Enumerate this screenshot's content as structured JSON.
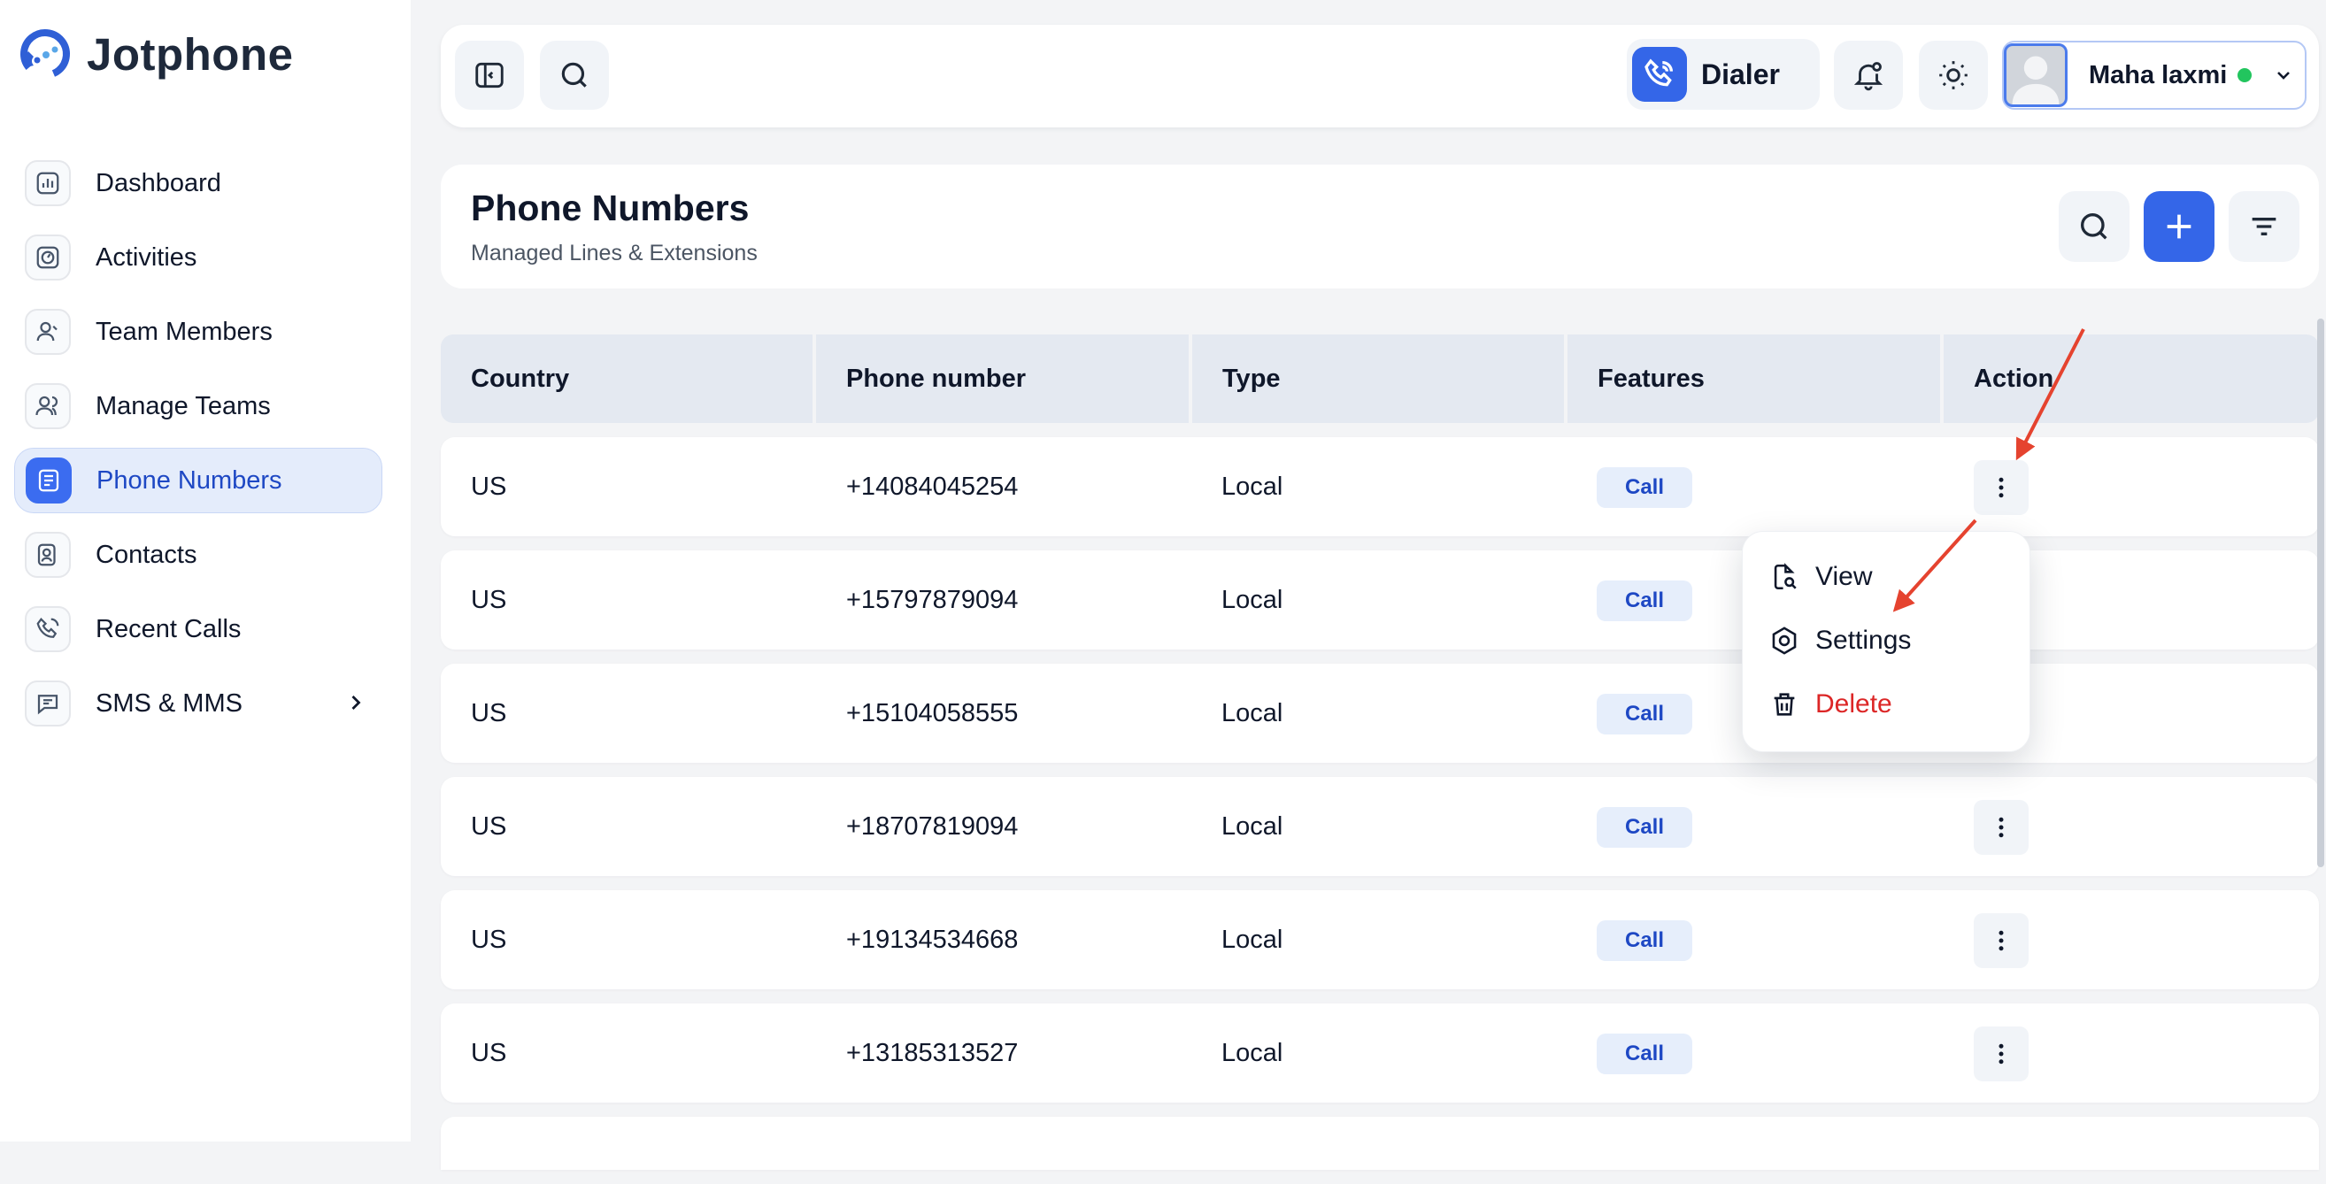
{
  "app": {
    "name": "Jotphone"
  },
  "sidebar": {
    "items": [
      {
        "label": "Dashboard",
        "icon": "chart-icon",
        "active": false
      },
      {
        "label": "Activities",
        "icon": "activity-icon",
        "active": false
      },
      {
        "label": "Team Members",
        "icon": "team-members-icon",
        "active": false
      },
      {
        "label": "Manage Teams",
        "icon": "manage-teams-icon",
        "active": false
      },
      {
        "label": "Phone Numbers",
        "icon": "phone-book-icon",
        "active": true
      },
      {
        "label": "Contacts",
        "icon": "contacts-icon",
        "active": false
      },
      {
        "label": "Recent Calls",
        "icon": "recent-calls-icon",
        "active": false
      },
      {
        "label": "SMS & MMS",
        "icon": "message-icon",
        "active": false,
        "has_submenu": true
      }
    ]
  },
  "topbar": {
    "dialer_label": "Dialer",
    "user_name": "Maha laxmi",
    "user_status_color": "#22c55e"
  },
  "page": {
    "title": "Phone Numbers",
    "subtitle": "Managed Lines & Extensions"
  },
  "table": {
    "columns": [
      "Country",
      "Phone number",
      "Type",
      "Features",
      "Action"
    ],
    "rows": [
      {
        "country": "US",
        "phone": "+14084045254",
        "type": "Local",
        "feature": "Call"
      },
      {
        "country": "US",
        "phone": "+15797879094",
        "type": "Local",
        "feature": "Call"
      },
      {
        "country": "US",
        "phone": "+15104058555",
        "type": "Local",
        "feature": "Call"
      },
      {
        "country": "US",
        "phone": "+18707819094",
        "type": "Local",
        "feature": "Call"
      },
      {
        "country": "US",
        "phone": "+19134534668",
        "type": "Local",
        "feature": "Call"
      },
      {
        "country": "US",
        "phone": "+13185313527",
        "type": "Local",
        "feature": "Call"
      }
    ]
  },
  "action_menu": {
    "view_label": "View",
    "settings_label": "Settings",
    "delete_label": "Delete"
  },
  "colors": {
    "accent": "#3466e8",
    "danger": "#dc2626",
    "annotation_arrow": "#e5432f"
  }
}
